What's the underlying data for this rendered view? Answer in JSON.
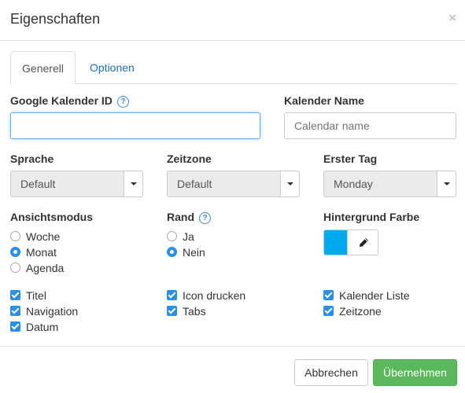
{
  "dialog": {
    "title": "Eigenschaften",
    "close_glyph": "×"
  },
  "tabs": [
    {
      "label": "Generell",
      "active": true
    },
    {
      "label": "Optionen",
      "active": false
    }
  ],
  "google_id": {
    "label": "Google Kalender ID",
    "help": "?",
    "value": "",
    "placeholder": ""
  },
  "calendar_name": {
    "label": "Kalender Name",
    "value": "",
    "placeholder": "Calendar name"
  },
  "language": {
    "label": "Sprache",
    "value": "Default"
  },
  "timezone": {
    "label": "Zeitzone",
    "value": "Default"
  },
  "first_day": {
    "label": "Erster Tag",
    "value": "Monday"
  },
  "view_mode": {
    "label": "Ansichtsmodus",
    "options": [
      {
        "label": "Woche",
        "selected": false
      },
      {
        "label": "Monat",
        "selected": true
      },
      {
        "label": "Agenda",
        "selected": false
      }
    ]
  },
  "border": {
    "label": "Rand",
    "help": "?",
    "options": [
      {
        "label": "Ja",
        "selected": false
      },
      {
        "label": "Nein",
        "selected": true
      }
    ]
  },
  "background": {
    "label": "Hintergrund Farbe",
    "color": "#00aaee",
    "edit_icon": "pencil-icon"
  },
  "checkboxes": {
    "col1": [
      {
        "label": "Titel",
        "checked": true
      },
      {
        "label": "Navigation",
        "checked": true
      },
      {
        "label": "Datum",
        "checked": true
      }
    ],
    "col2": [
      {
        "label": "Icon drucken",
        "checked": true
      },
      {
        "label": "Tabs",
        "checked": true
      }
    ],
    "col3": [
      {
        "label": "Kalender Liste",
        "checked": true
      },
      {
        "label": "Zeitzone",
        "checked": true
      }
    ]
  },
  "footer": {
    "cancel_label": "Abbrechen",
    "submit_label": "Übernehmen"
  },
  "colors": {
    "accent": "#2a8fe6",
    "link": "#1f6fb5",
    "success": "#5cb85c"
  }
}
